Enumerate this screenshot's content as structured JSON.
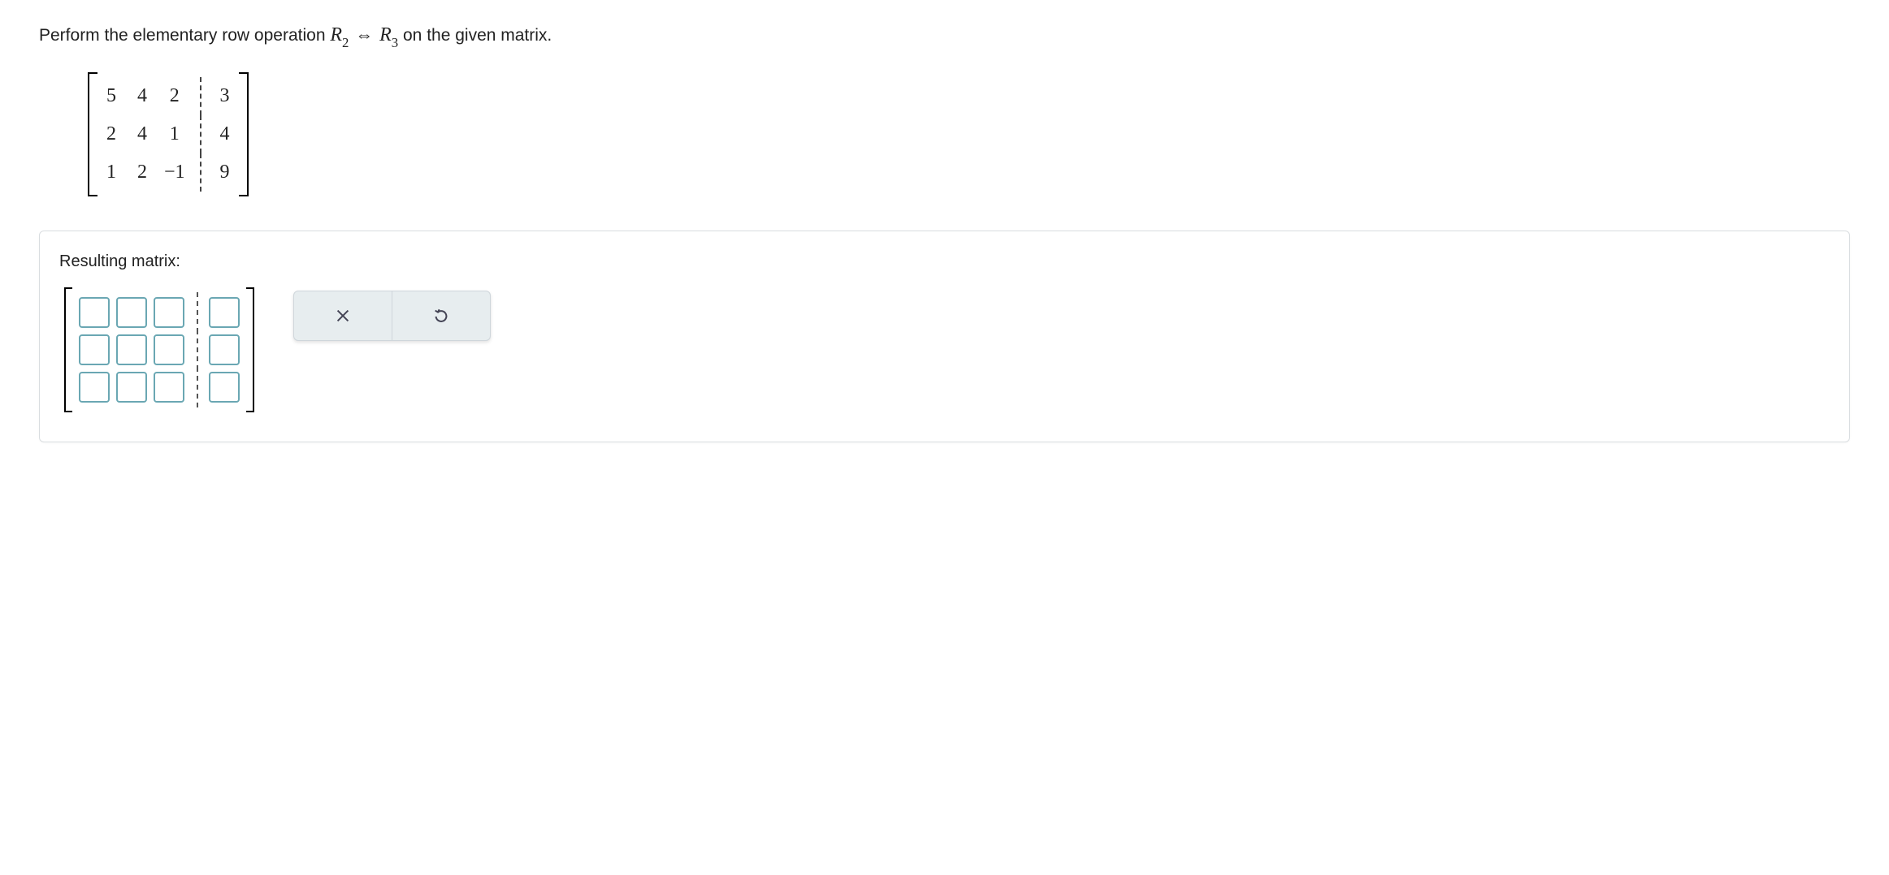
{
  "question": {
    "prefix": "Perform the elementary row operation ",
    "op_r2": "R",
    "op_sub2": "2",
    "op_r3": "R",
    "op_sub3": "3",
    "suffix": " on the given matrix."
  },
  "given_matrix": {
    "rows": [
      {
        "c1": "5",
        "c2": "4",
        "c3": "2",
        "aug": "3"
      },
      {
        "c1": "2",
        "c2": "4",
        "c3": "1",
        "aug": "4"
      },
      {
        "c1": "1",
        "c2": "2",
        "c3": "−1",
        "aug": "9"
      }
    ]
  },
  "panel": {
    "label": "Resulting matrix:"
  },
  "input_matrix": {
    "rows": 3,
    "cols": 3,
    "aug_cols": 1,
    "values": [
      [
        "",
        "",
        "",
        ""
      ],
      [
        "",
        "",
        "",
        ""
      ],
      [
        "",
        "",
        "",
        ""
      ]
    ]
  },
  "toolbar": {
    "clear_name": "clear-button",
    "reset_name": "reset-button"
  }
}
